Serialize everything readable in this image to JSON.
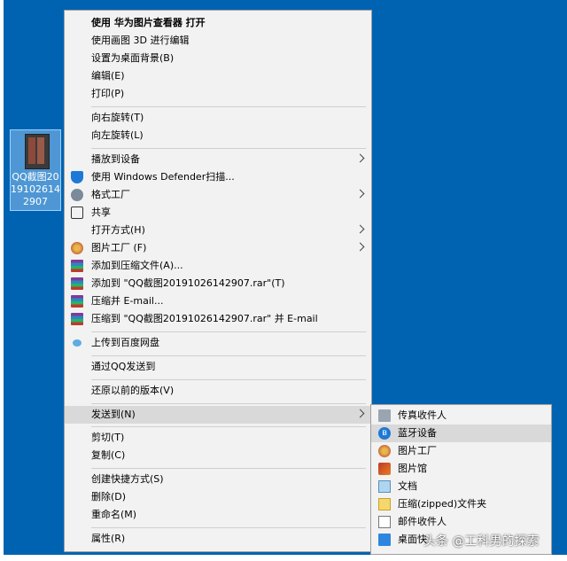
{
  "desktop_icon": {
    "label": "QQ截图20191026142907"
  },
  "menu": {
    "items": [
      {
        "label": "使用 华为图片查看器 打开"
      },
      {
        "label": "使用画图 3D 进行编辑"
      },
      {
        "label": "设置为桌面背景(B)"
      },
      {
        "label": "编辑(E)"
      },
      {
        "label": "打印(P)"
      },
      {
        "label": "向右旋转(T)"
      },
      {
        "label": "向左旋转(L)"
      },
      {
        "label": "播放到设备"
      },
      {
        "label": "使用 Windows Defender扫描..."
      },
      {
        "label": "格式工厂"
      },
      {
        "label": "共享"
      },
      {
        "label": "打开方式(H)"
      },
      {
        "label": "图片工厂 (F)"
      },
      {
        "label": "添加到压缩文件(A)..."
      },
      {
        "label": "添加到 \"QQ截图20191026142907.rar\"(T)"
      },
      {
        "label": "压缩并 E-mail..."
      },
      {
        "label": "压缩到 \"QQ截图20191026142907.rar\" 并 E-mail"
      },
      {
        "label": "上传到百度网盘"
      },
      {
        "label": "通过QQ发送到"
      },
      {
        "label": "还原以前的版本(V)"
      },
      {
        "label": "发送到(N)"
      },
      {
        "label": "剪切(T)"
      },
      {
        "label": "复制(C)"
      },
      {
        "label": "创建快捷方式(S)"
      },
      {
        "label": "删除(D)"
      },
      {
        "label": "重命名(M)"
      },
      {
        "label": "属性(R)"
      }
    ]
  },
  "submenu": {
    "items": [
      {
        "label": "传真收件人"
      },
      {
        "label": "蓝牙设备"
      },
      {
        "label": "图片工厂"
      },
      {
        "label": "图片馆"
      },
      {
        "label": "文档"
      },
      {
        "label": "压缩(zipped)文件夹"
      },
      {
        "label": "邮件收件人"
      },
      {
        "label": "桌面快"
      }
    ]
  },
  "bluetooth_glyph": "ʙ",
  "watermark": "头条 @工科男的探索"
}
